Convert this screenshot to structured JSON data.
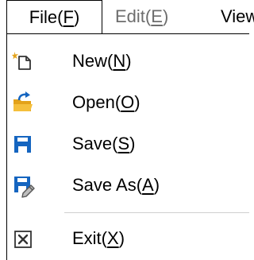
{
  "menubar": {
    "file": {
      "text": "File(",
      "key": "F",
      "end": ")"
    },
    "edit": {
      "text": "Edit(",
      "key": "E",
      "end": ")"
    },
    "view": {
      "text": "View"
    }
  },
  "file_menu": {
    "items": [
      {
        "text": "New(",
        "key": "N",
        "end": ")",
        "icon": "new-file-icon"
      },
      {
        "text": "Open(",
        "key": "O",
        "end": ")",
        "icon": "open-folder-icon"
      },
      {
        "text": "Save(",
        "key": "S",
        "end": ")",
        "icon": "save-disk-icon"
      },
      {
        "text": "Save As(",
        "key": "A",
        "end": ")",
        "icon": "save-as-icon"
      },
      {
        "text": "Exit(",
        "key": "X",
        "end": ")",
        "icon": "exit-icon"
      }
    ]
  },
  "colors": {
    "accent_blue": "#1565c0",
    "folder_yellow": "#e3a21a",
    "disabled_text": "#6d6d6d",
    "separator": "#cfcfcf"
  }
}
